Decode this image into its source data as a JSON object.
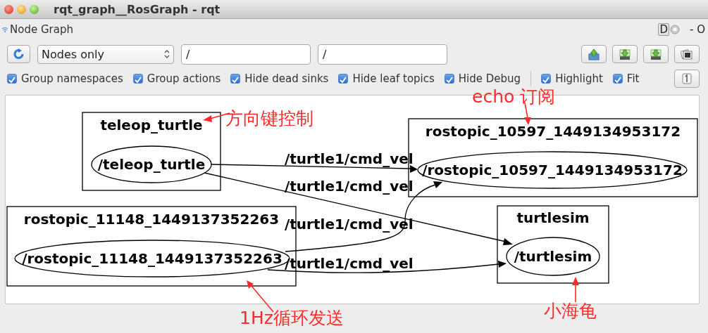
{
  "window": {
    "title": "rqt_graph__RosGraph - rqt"
  },
  "panel": {
    "title": "Node Graph",
    "dock_label": "D",
    "close_label": "- O"
  },
  "toolbar": {
    "mode": "Nodes only",
    "node_filter": "/",
    "topic_filter": "/"
  },
  "options": [
    {
      "label": "Group namespaces",
      "checked": true,
      "separator_before": false
    },
    {
      "label": "Group actions",
      "checked": true,
      "separator_before": false
    },
    {
      "label": "Hide dead sinks",
      "checked": true,
      "separator_before": false
    },
    {
      "label": "Hide leaf topics",
      "checked": true,
      "separator_before": false
    },
    {
      "label": "Hide Debug",
      "checked": true,
      "separator_before": false
    },
    {
      "label": "Highlight",
      "checked": true,
      "separator_before": true
    },
    {
      "label": "Fit",
      "checked": true,
      "separator_before": false
    }
  ],
  "graph": {
    "groups": [
      {
        "title": "teleop_turtle",
        "node": "/teleop_turtle"
      },
      {
        "title": "rostopic_10597_1449134953172",
        "node": "/rostopic_10597_1449134953172"
      },
      {
        "title": "rostopic_11148_1449137352263",
        "node": "/rostopic_11148_1449137352263"
      },
      {
        "title": "turtlesim",
        "node": "/turtlesim"
      }
    ],
    "edges": [
      {
        "label": "/turtle1/cmd_vel"
      },
      {
        "label": "/turtle1/cmd_vel"
      },
      {
        "label": "/turtle1/cmd_vel"
      },
      {
        "label": "/turtle1/cmd_vel"
      }
    ]
  },
  "annotations": [
    {
      "text": "方向键控制"
    },
    {
      "text": "echo 订阅"
    },
    {
      "text": "1Hz循环发送"
    },
    {
      "text": "小海龟"
    }
  ]
}
